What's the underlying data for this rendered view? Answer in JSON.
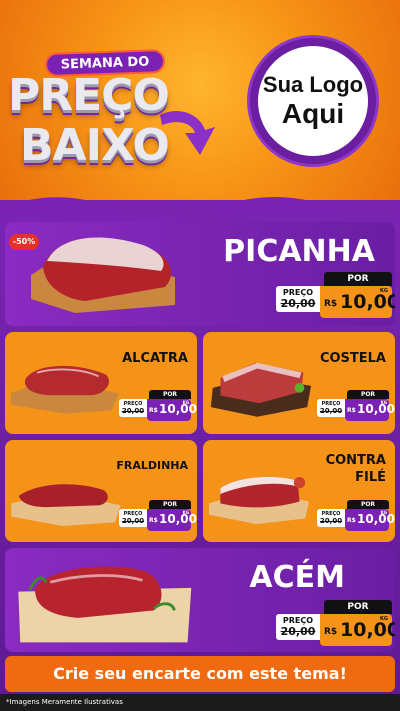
{
  "header": {
    "banner_top": "SEMANA DO",
    "title_line1": "PREÇO",
    "title_line2": "BAIXO",
    "logo_line1": "Sua Logo",
    "logo_line2": "Aqui"
  },
  "products": [
    {
      "name": "PICANHA",
      "discount": "-50%",
      "preco_label": "PREÇO",
      "de": "De",
      "old_price": "20,00",
      "por": "POR",
      "currency": "R$",
      "new_price": "10,00",
      "unit": "KG"
    },
    {
      "name": "ALCATRA",
      "preco_label": "PREÇO",
      "old_price": "20,00",
      "por": "POR",
      "currency": "R$",
      "new_price": "10,00",
      "unit": "KG"
    },
    {
      "name": "COSTELA",
      "preco_label": "PREÇO",
      "old_price": "20,00",
      "por": "POR",
      "currency": "R$",
      "new_price": "10,00",
      "unit": "KG"
    },
    {
      "name": "FRALDINHA",
      "preco_label": "PREÇO",
      "old_price": "20,00",
      "por": "POR",
      "currency": "R$",
      "new_price": "10,00",
      "unit": "KG"
    },
    {
      "name_line1": "CONTRA",
      "name_line2": "FILÉ",
      "preco_label": "PREÇO",
      "old_price": "20,00",
      "por": "POR",
      "currency": "R$",
      "new_price": "10,00",
      "unit": "KG"
    },
    {
      "name": "ACÉM",
      "preco_label": "PREÇO",
      "de": "De",
      "old_price": "20,00",
      "por": "POR",
      "currency": "R$",
      "new_price": "10,00",
      "unit": "KG"
    }
  ],
  "cta": "Crie seu encarte com este tema!",
  "footer": "*Imagens Meramente Ilustrativas",
  "colors": {
    "purple": "#7b22b4",
    "orange": "#f59318",
    "cta": "#f06a12",
    "badge": "#e8302a"
  }
}
